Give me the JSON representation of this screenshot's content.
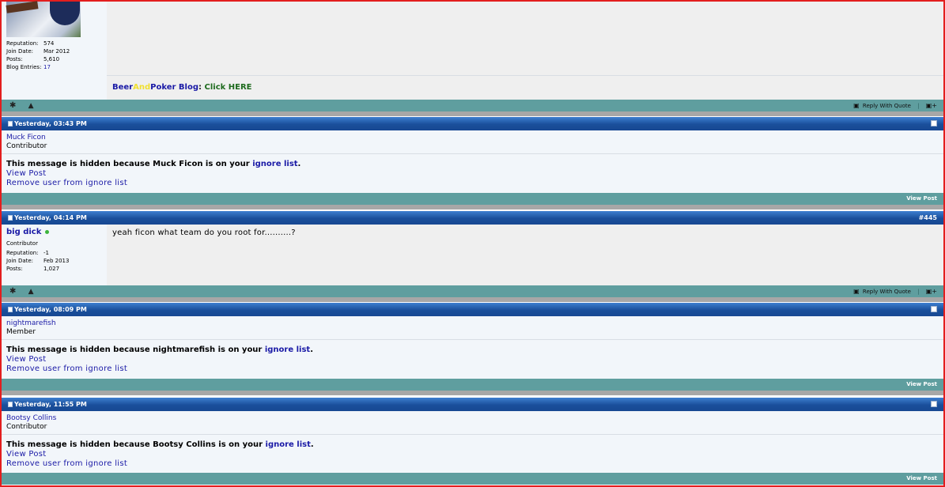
{
  "post1": {
    "stats": [
      {
        "k": "Reputation:",
        "v": "574"
      },
      {
        "k": "Join Date:",
        "v": "Mar 2012"
      },
      {
        "k": "Posts:",
        "v": "5,610"
      },
      {
        "k": "Blog Entries:",
        "v": "17"
      }
    ],
    "sig_beer": "Beer",
    "sig_and": "And",
    "sig_poker": "Poker Blog",
    "sig_colon": ": ",
    "sig_click": "Click HERE",
    "reply_with_quote": "Reply With Quote"
  },
  "post2": {
    "date": "Yesterday, 03:43 PM",
    "username": "Muck Ficon",
    "title": "Contributor",
    "hidden_prefix": "This message is hidden because Muck Ficon is on your ",
    "ignore_list": "ignore list",
    "period": ".",
    "view_post": "View Post",
    "remove": "Remove user from ignore list",
    "bar_view_post": "View Post"
  },
  "post3": {
    "date": "Yesterday, 04:14 PM",
    "post_number": "#445",
    "username": "big dick",
    "title": "Contributor",
    "stats": [
      {
        "k": "Reputation:",
        "v": "-1"
      },
      {
        "k": "Join Date:",
        "v": "Feb 2013"
      },
      {
        "k": "Posts:",
        "v": "1,027"
      }
    ],
    "message": "yeah ficon what team do you root for..........?",
    "reply_with_quote": "Reply With Quote"
  },
  "post4": {
    "date": "Yesterday, 08:09 PM",
    "username": "nightmarefish",
    "title": "Member",
    "hidden_prefix": "This message is hidden because nightmarefish is on your ",
    "ignore_list": "ignore list",
    "period": ".",
    "view_post": "View Post",
    "remove": "Remove user from ignore list",
    "bar_view_post": "View Post"
  },
  "post5": {
    "date": "Yesterday, 11:55 PM",
    "username": "Bootsy Collins",
    "title": "Contributor",
    "hidden_prefix": "This message is hidden because Bootsy Collins is on your ",
    "ignore_list": "ignore list",
    "period": ".",
    "view_post": "View Post",
    "remove": "Remove user from ignore list",
    "bar_view_post": "View Post"
  },
  "icons": {
    "star": "star-icon",
    "warning": "warning-icon",
    "reply": "speech-bubble-icon",
    "multiquote": "multiquote-icon",
    "post_status": "post-icon",
    "checkbox": "checkbox-icon"
  },
  "colors": {
    "accent_blue": "#1a4f9b",
    "teal_bar": "#5f9e9f",
    "frame_red": "#e31e1e",
    "link": "#1a1aa6",
    "sig_beer": "#1a1aa6",
    "sig_and": "#f0e030",
    "sig_click": "#1e6b1e"
  }
}
